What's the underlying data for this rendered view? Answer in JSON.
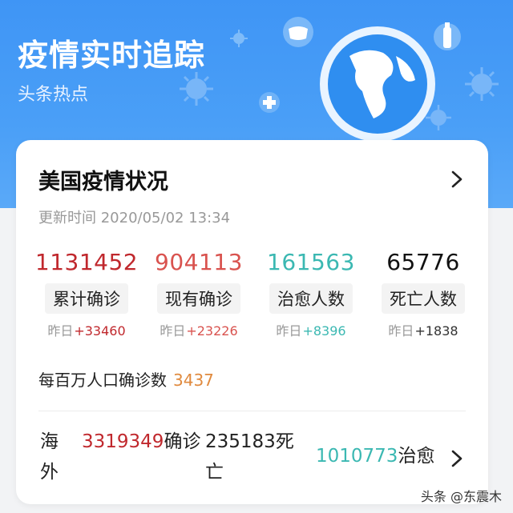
{
  "banner": {
    "title": "疫情实时追踪",
    "subtitle": "头条热点"
  },
  "card": {
    "title": "美国疫情状况",
    "update_label": "更新时间",
    "update_time": "2020/05/02 13:34",
    "stats": [
      {
        "value": "1131452",
        "label": "累计确诊",
        "yday_prefix": "昨日",
        "yday_delta": "+33460",
        "color": "#c0282d",
        "delta_color": "#c0282d"
      },
      {
        "value": "904113",
        "label": "现有确诊",
        "yday_prefix": "昨日",
        "yday_delta": "+23226",
        "color": "#d9534f",
        "delta_color": "#d9534f"
      },
      {
        "value": "161563",
        "label": "治愈人数",
        "yday_prefix": "昨日",
        "yday_delta": "+8396",
        "color": "#3bb8b2",
        "delta_color": "#3bb8b2"
      },
      {
        "value": "65776",
        "label": "死亡人数",
        "yday_prefix": "昨日",
        "yday_delta": "+1838",
        "color": "#111111",
        "delta_color": "#333333"
      }
    ],
    "per_million_label": "每百万人口确诊数",
    "per_million_value": "3437",
    "overseas": {
      "label": "海外",
      "confirmed_value": "3319349",
      "confirmed_label": "确诊",
      "deaths_value": "235183",
      "deaths_label": "死亡",
      "recovered_value": "1010773",
      "recovered_label": "治愈",
      "confirmed_color": "#c0282d",
      "recovered_color": "#3bb8b2"
    }
  },
  "watermark": "头条 @东震木",
  "colors": {
    "banner": "#4a9ff7",
    "per_million": "#e08a3e"
  }
}
